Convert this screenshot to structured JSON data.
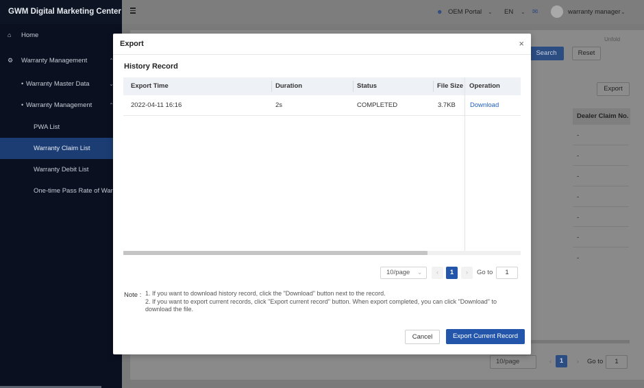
{
  "app": {
    "brand": "GWM Digital Marketing Center",
    "sidebar": {
      "home": "Home",
      "warranty_management": "Warranty Management",
      "warranty_master_data": "Warranty Master Data",
      "warranty_management_sub": "Warranty Management",
      "pwa_list": "PWA List",
      "warranty_claim_list": "Warranty Claim List",
      "warranty_debit_list": "Warranty Debit List",
      "one_time_pass": "One-time Pass Rate of Warr"
    },
    "topbar": {
      "portal": "OEM Portal",
      "language": "EN",
      "user": "warranty manager"
    },
    "background": {
      "unfold": "Unfold",
      "search_button": "Search",
      "reset_button": "Reset",
      "export_button": "Export",
      "column_header": "Dealer Claim No.",
      "cell_dash": "-",
      "page_size": "10/page",
      "page_number": "1",
      "goto_label": "Go to",
      "goto_value": "1"
    }
  },
  "modal": {
    "title": "Export",
    "close_label": "×",
    "section_title": "History Record",
    "columns": {
      "export_time": "Export Time",
      "duration": "Duration",
      "status": "Status",
      "file_size": "File Size",
      "operation": "Operation"
    },
    "rows": [
      {
        "export_time": "2022-04-11 16:16",
        "duration": "2s",
        "status": "COMPLETED",
        "file_size": "3.7KB",
        "operation": "Download"
      }
    ],
    "pagination": {
      "page_size": "10/page",
      "current_page": "1",
      "goto_label": "Go to",
      "goto_value": "1"
    },
    "note": {
      "label": "Note :",
      "line1": "1. If you want to download history record, click the \"Download\" button next to the record.",
      "line2": "2. If you want to export current records, click \"Export current record\" button. When export completed, you can click \"Download\" to download the file."
    },
    "cancel_button": "Cancel",
    "export_current_button": "Export Current Record"
  }
}
